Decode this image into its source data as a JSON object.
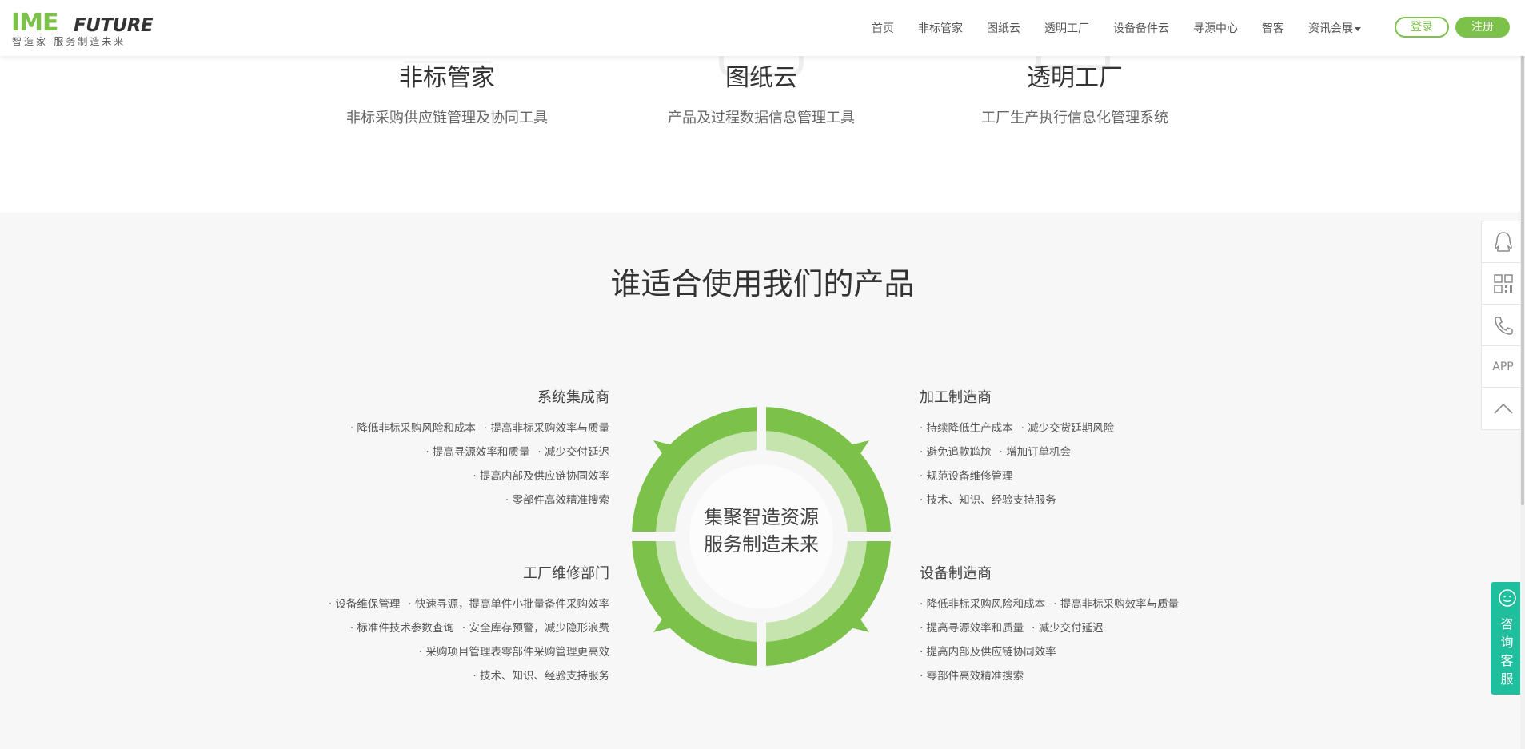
{
  "header": {
    "logo": {
      "brand_main": "IME",
      "brand_sub": "FUTURE",
      "slogan": "智造家-服务制造未来"
    },
    "nav": [
      "首页",
      "非标管家",
      "图纸云",
      "透明工厂",
      "设备备件云",
      "寻源中心",
      "智客",
      "资讯会展"
    ],
    "login_label": "登录",
    "register_label": "注册"
  },
  "products": [
    {
      "name": "非标管家",
      "desc": "非标采购供应链管理及协同工具"
    },
    {
      "name": "图纸云",
      "desc": "产品及过程数据信息管理工具"
    },
    {
      "name": "透明工厂",
      "desc": "工厂生产执行信息化管理系统"
    }
  ],
  "audience": {
    "title": "谁适合使用我们的产品",
    "center_text_1": "集聚智造资源",
    "center_text_2": "服务制造未来",
    "groups": [
      {
        "title": "系统集成商",
        "lines": [
          [
            "降低非标采购风险和成本",
            "提高非标采购效率与质量"
          ],
          [
            "提高寻源效率和质量",
            "减少交付延迟"
          ],
          [
            "提高内部及供应链协同效率"
          ],
          [
            "零部件高效精准搜索"
          ]
        ]
      },
      {
        "title": "加工制造商",
        "lines": [
          [
            "持续降低生产成本",
            "减少交货延期风险"
          ],
          [
            "避免追款尴尬",
            "增加订单机会"
          ],
          [
            "规范设备维修管理"
          ],
          [
            "技术、知识、经验支持服务"
          ]
        ]
      },
      {
        "title": "工厂维修部门",
        "lines": [
          [
            "设备维保管理",
            "快速寻源，提高单件小批量备件采购效率"
          ],
          [
            "标准件技术参数查询",
            "安全库存预警，减少隐形浪费"
          ],
          [
            "采购项目管理表零部件采购管理更高效"
          ],
          [
            "技术、知识、经验支持服务"
          ]
        ]
      },
      {
        "title": "设备制造商",
        "lines": [
          [
            "降低非标采购风险和成本",
            "提高非标采购效率与质量"
          ],
          [
            "提高寻源效率和质量",
            "减少交付延迟"
          ],
          [
            "提高内部及供应链协同效率"
          ],
          [
            "零部件高效精准搜索"
          ]
        ]
      }
    ]
  },
  "side_tools": {
    "app_label": "APP"
  },
  "consult": {
    "label": "咨询客服"
  },
  "colors": {
    "brand_green": "#7cc24a",
    "light_green": "#c6e4ae",
    "consult_teal": "#1fbf9d"
  }
}
